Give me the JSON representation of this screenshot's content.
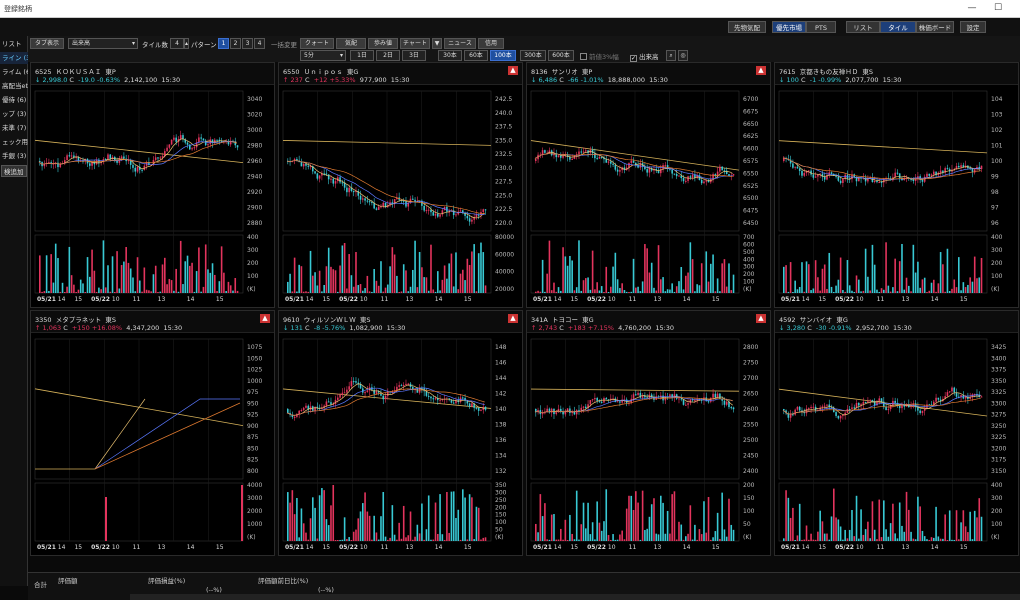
{
  "window": {
    "title": "登録銘柄",
    "min": "—",
    "max": "☐"
  },
  "topbar": {
    "btn1": "先物気配",
    "btn2": "優先市場",
    "btn3": "PTS",
    "btn4": "リスト",
    "btn5": "タイル",
    "btn6": "株価ボード",
    "btn7": "設定",
    "nav": [
      "◀◀",
      "◀",
      "▶",
      "▶▶"
    ]
  },
  "toolbar": {
    "tab_display": "タブ表示",
    "dropdown": "出来高",
    "tiles_label": "タイル数",
    "tiles_value": "4",
    "pattern_label": "パターン",
    "patterns": [
      "1",
      "2",
      "3",
      "4"
    ],
    "bulk_label": "一括変更",
    "b_quote": "クォート",
    "b_depth": "気配",
    "b_tick": "歩み値",
    "b_chart": "チャート",
    "b_news": "ニュース",
    "b_credit": "信用",
    "interval": "5分",
    "ranges": [
      "1日",
      "2日",
      "3日",
      "30本",
      "60本",
      "100本",
      "300本",
      "600本"
    ],
    "selected_range": "100本",
    "opt1": "前値3%幅",
    "opt2": "出来高"
  },
  "sidebar": {
    "items": [
      "リスト",
      "ライン (32)",
      "ライム (6)",
      "高配当etf",
      "優待 (6)",
      "ップ (3)",
      "未準 (7)",
      "ェック用 (",
      "手銀 (3)",
      "検追加"
    ]
  },
  "panels": [
    {
      "code": "6525",
      "name": "ＫＯＫＵＳＡＩ",
      "market": "東P",
      "arrow": "↓",
      "price": "2,998.0",
      "c": "C",
      "change": "-19.0",
      "pct": "-0.63%",
      "volume": "2,142,100",
      "time": "15:30",
      "dir": "dn",
      "yticks": [
        "3040",
        "3020",
        "3000",
        "2980",
        "2960",
        "2940",
        "2920",
        "2900",
        "2880"
      ],
      "vticks": [
        "400",
        "300",
        "200",
        "100",
        "(K)"
      ],
      "xticks": [
        "05/21",
        "14",
        "15",
        "05/22",
        "10",
        "11",
        "13",
        "14",
        "15"
      ],
      "alert": false
    },
    {
      "code": "6550",
      "name": "Ｕｎｉｐｏｓ",
      "market": "東G",
      "arrow": "↑",
      "price": "237",
      "c": "C",
      "change": "+12",
      "pct": "+5.33%",
      "volume": "977,900",
      "time": "15:30",
      "dir": "up",
      "yticks": [
        "242.5",
        "240.0",
        "237.5",
        "235.0",
        "232.5",
        "230.0",
        "227.5",
        "225.0",
        "222.5",
        "220.0"
      ],
      "vticks": [
        "80000",
        "60000",
        "40000",
        "20000"
      ],
      "xticks": [
        "05/21",
        "14",
        "15",
        "05/22",
        "10",
        "11",
        "13",
        "14",
        "15"
      ],
      "alert": true
    },
    {
      "code": "8136",
      "name": "サンリオ",
      "market": "東P",
      "arrow": "↓",
      "price": "6,486",
      "c": "C",
      "change": "-66",
      "pct": "-1.01%",
      "volume": "18,888,000",
      "time": "15:30",
      "dir": "dn",
      "yticks": [
        "6700",
        "6675",
        "6650",
        "6625",
        "6600",
        "6575",
        "6550",
        "6525",
        "6500",
        "6475",
        "6450"
      ],
      "vticks": [
        "700",
        "600",
        "500",
        "400",
        "300",
        "200",
        "100",
        "(K)"
      ],
      "xticks": [
        "05/21",
        "14",
        "15",
        "05/22",
        "10",
        "11",
        "13",
        "14",
        "15"
      ],
      "alert": true
    },
    {
      "code": "7615",
      "name": "京都きもの友禅ＨＤ",
      "market": "東S",
      "arrow": "↓",
      "price": "100",
      "c": "C",
      "change": "-1",
      "pct": "-0.99%",
      "volume": "2,077,700",
      "time": "15:30",
      "dir": "dn",
      "yticks": [
        "104",
        "103",
        "102",
        "101",
        "100",
        "99",
        "98",
        "97",
        "96"
      ],
      "vticks": [
        "400",
        "300",
        "200",
        "100",
        "(K)"
      ],
      "xticks": [
        "05/21",
        "14",
        "15",
        "05/22",
        "10",
        "11",
        "13",
        "14",
        "15"
      ],
      "alert": false
    },
    {
      "code": "3350",
      "name": "メタプラネット",
      "market": "東S",
      "arrow": "↑",
      "price": "1,063",
      "c": "C",
      "change": "+150",
      "pct": "+16.08%",
      "volume": "4,347,200",
      "time": "15:30",
      "dir": "up",
      "yticks": [
        "1075",
        "1050",
        "1025",
        "1000",
        "975",
        "950",
        "925",
        "900",
        "875",
        "850",
        "825",
        "800"
      ],
      "vticks": [
        "4000",
        "3000",
        "2000",
        "1000",
        "(K)"
      ],
      "xticks": [
        "05/21",
        "14",
        "15",
        "05/22",
        "10",
        "11",
        "13",
        "14",
        "15"
      ],
      "alert": true
    },
    {
      "code": "9610",
      "name": "ウィルソンＷＬＷ",
      "market": "東S",
      "arrow": "↓",
      "price": "131",
      "c": "C",
      "change": "-8",
      "pct": "-5.76%",
      "volume": "1,082,900",
      "time": "15:30",
      "dir": "dn",
      "yticks": [
        "148",
        "146",
        "144",
        "142",
        "140",
        "138",
        "136",
        "134",
        "132"
      ],
      "vticks": [
        "350",
        "300",
        "250",
        "200",
        "150",
        "100",
        "50",
        "(K)"
      ],
      "xticks": [
        "05/21",
        "14",
        "15",
        "05/22",
        "10",
        "11",
        "13",
        "14",
        "15"
      ],
      "alert": true
    },
    {
      "code": "341A",
      "name": "トヨコー",
      "market": "東G",
      "arrow": "↑",
      "price": "2,743",
      "c": "C",
      "change": "+183",
      "pct": "+7.15%",
      "volume": "4,760,200",
      "time": "15:30",
      "dir": "up",
      "yticks": [
        "2800",
        "2750",
        "2700",
        "2650",
        "2600",
        "2550",
        "2500",
        "2450",
        "2400"
      ],
      "vticks": [
        "200",
        "150",
        "100",
        "50",
        "(K)"
      ],
      "xticks": [
        "05/21",
        "14",
        "15",
        "05/22",
        "10",
        "11",
        "13",
        "14",
        "15"
      ],
      "alert": true
    },
    {
      "code": "4592",
      "name": "サンバイオ",
      "market": "東G",
      "arrow": "↓",
      "price": "3,280",
      "c": "C",
      "change": "-30",
      "pct": "-0.91%",
      "volume": "2,952,700",
      "time": "15:30",
      "dir": "dn",
      "yticks": [
        "3425",
        "3400",
        "3375",
        "3350",
        "3325",
        "3300",
        "3275",
        "3250",
        "3225",
        "3200",
        "3175",
        "3150"
      ],
      "vticks": [
        "400",
        "300",
        "200",
        "100",
        "(K)"
      ],
      "xticks": [
        "05/21",
        "14",
        "15",
        "05/22",
        "10",
        "11",
        "13",
        "14",
        "15"
      ],
      "alert": false
    }
  ],
  "bottom": {
    "h0": "合計",
    "h1": "評価額",
    "h2": "評価損益(%)",
    "h3": "評価額前日比(%)",
    "v1": "",
    "v2": "(--%)",
    "v3": "(--%)"
  },
  "colors": {
    "up": "#e3345d",
    "down": "#38c9d4",
    "ma1": "#e8c070",
    "ma2": "#5a78ff",
    "ma3": "#e07a30",
    "ref": "#d6b25a"
  }
}
